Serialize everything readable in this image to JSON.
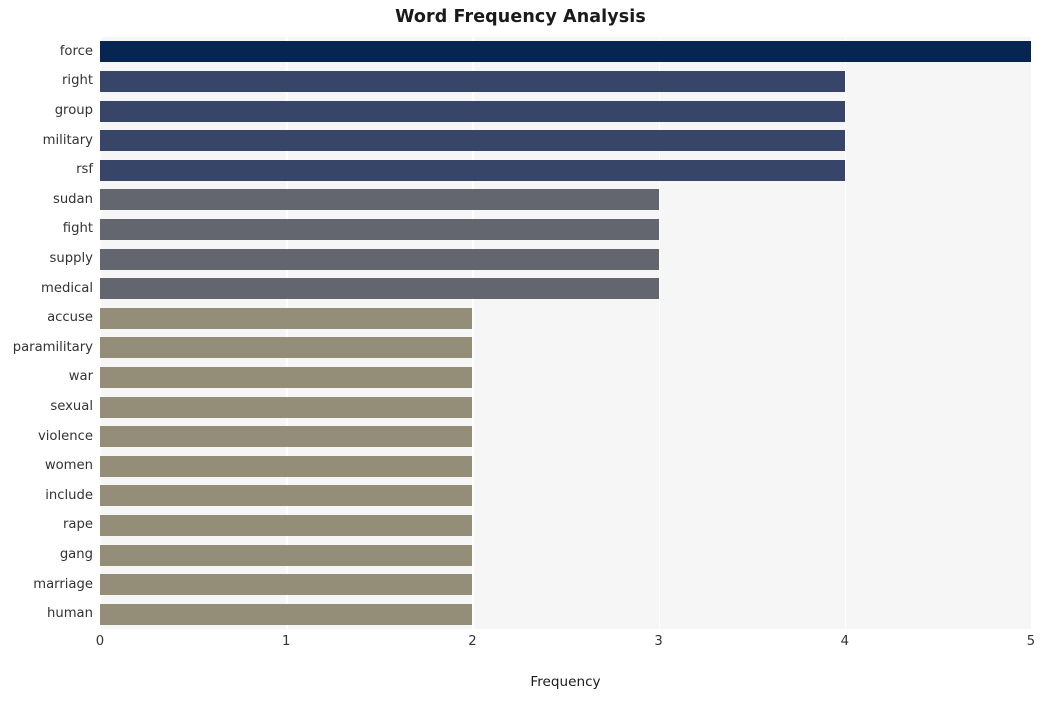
{
  "chart_data": {
    "type": "bar",
    "orientation": "horizontal",
    "title": "Word Frequency Analysis",
    "xlabel": "Frequency",
    "ylabel": "",
    "categories": [
      "force",
      "right",
      "group",
      "military",
      "rsf",
      "sudan",
      "fight",
      "supply",
      "medical",
      "accuse",
      "paramilitary",
      "war",
      "sexual",
      "violence",
      "women",
      "include",
      "rape",
      "gang",
      "marriage",
      "human"
    ],
    "values": [
      5,
      4,
      4,
      4,
      4,
      3,
      3,
      3,
      3,
      2,
      2,
      2,
      2,
      2,
      2,
      2,
      2,
      2,
      2,
      2
    ],
    "bar_colors": [
      "#062550",
      "#374568",
      "#374568",
      "#374568",
      "#374568",
      "#63666f",
      "#63666f",
      "#63666f",
      "#63666f",
      "#948e78",
      "#948e78",
      "#948e78",
      "#948e78",
      "#948e78",
      "#948e78",
      "#948e78",
      "#948e78",
      "#948e78",
      "#948e78",
      "#948e78"
    ],
    "xlim": [
      0,
      5
    ],
    "xticks": [
      0,
      1,
      2,
      3,
      4,
      5
    ],
    "xtick_labels": [
      "0",
      "1",
      "2",
      "3",
      "4",
      "5"
    ],
    "grid": true,
    "grid_axis": "x",
    "grid_color": "#ffffff",
    "legend": false,
    "plot_background": "#f6f6f7",
    "figure_background": "#ffffff",
    "title_color": "#1a1a1a",
    "tick_label_color": "#333333"
  }
}
